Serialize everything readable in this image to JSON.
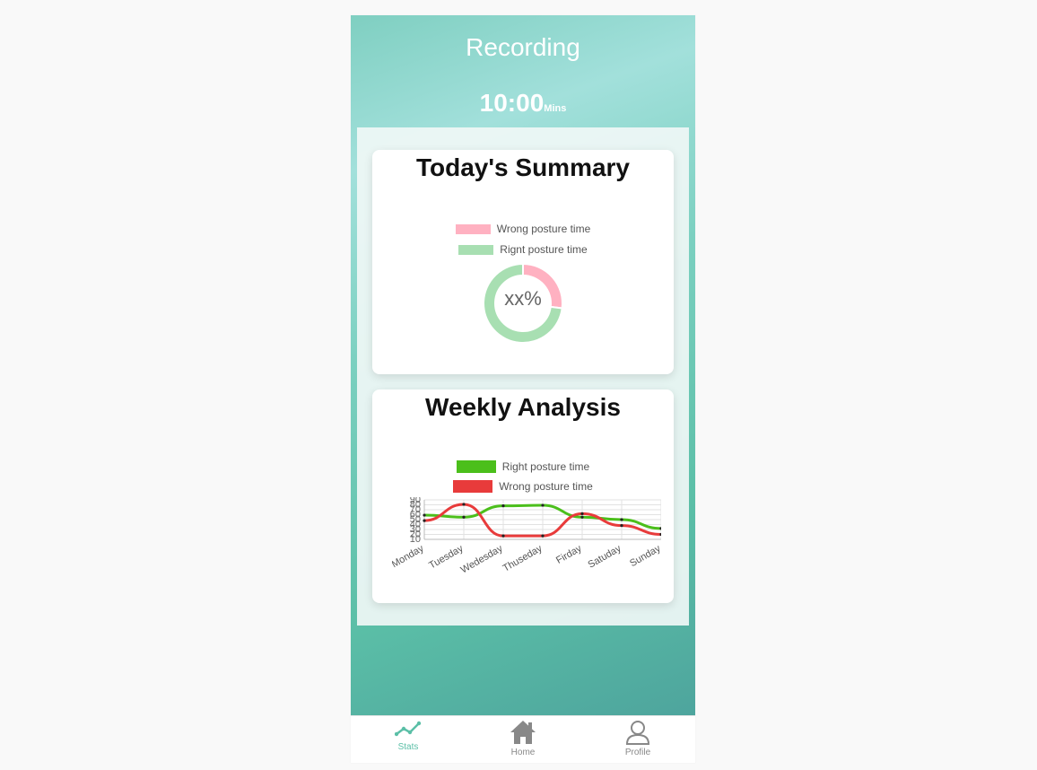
{
  "header": {
    "title": "Recording",
    "timer_value": "10:00",
    "timer_unit": "Mins"
  },
  "summary": {
    "title": "Today's Summary",
    "center_label": "xx%",
    "legend": [
      {
        "label": "Wrong posture time",
        "color": "#ffb1c1"
      },
      {
        "label": "Rignt posture time",
        "color": "#a8dfb2"
      }
    ]
  },
  "weekly": {
    "title": "Weekly Analysis",
    "legend": [
      {
        "label": "Right posture time",
        "color": "#4bbf1b"
      },
      {
        "label": "Wrong posture time",
        "color": "#e83b3b"
      }
    ]
  },
  "chart_data": [
    {
      "type": "pie",
      "variant": "donut",
      "labels": [
        "Wrong posture time",
        "Rignt posture time"
      ],
      "values": [
        27,
        73
      ],
      "colors": [
        "#ffb1c1",
        "#a8dfb2"
      ],
      "center_text": "xx%",
      "legend": "top"
    },
    {
      "type": "line",
      "categories": [
        "Monday",
        "Tuesday",
        "Wedesday",
        "Thuseday",
        "Firday",
        "Satuday",
        "Sunday"
      ],
      "series": [
        {
          "name": "Right posture time",
          "color": "#4bbf1b",
          "values": [
            59,
            55,
            78,
            79,
            55,
            50,
            32
          ]
        },
        {
          "name": "Wrong posture time",
          "color": "#e83b3b",
          "values": [
            48,
            81,
            17,
            17,
            62,
            38,
            20
          ]
        }
      ],
      "yticks": [
        10,
        20,
        30,
        40,
        50,
        60,
        70,
        80,
        90
      ],
      "ylim": [
        10,
        90
      ],
      "grid": true,
      "legend": "top"
    }
  ],
  "nav": {
    "items": [
      {
        "label": "Stats",
        "icon": "stats-icon",
        "active": true
      },
      {
        "label": "Home",
        "icon": "home-icon",
        "active": false
      },
      {
        "label": "Profile",
        "icon": "profile-icon",
        "active": false
      }
    ],
    "active_color": "#5bbfa7",
    "inactive_color": "#888888"
  }
}
